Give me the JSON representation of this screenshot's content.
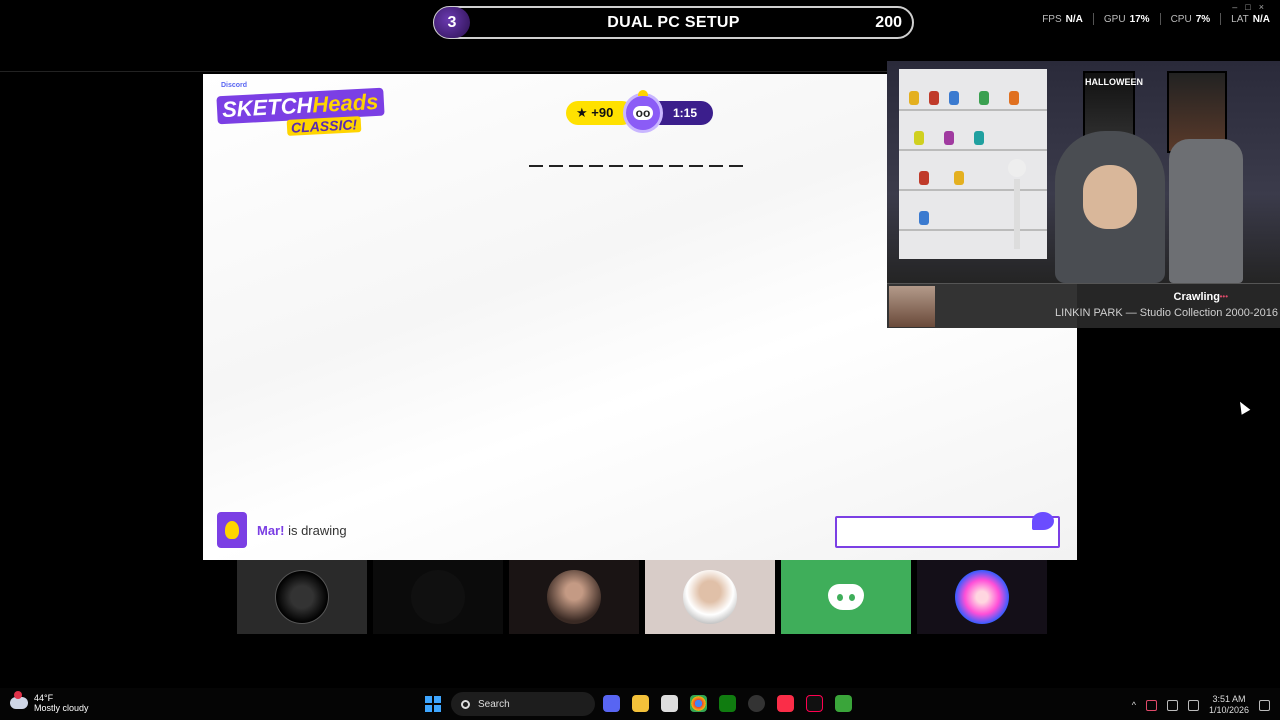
{
  "overlay": {
    "round": "3",
    "title": "DUAL PC SETUP",
    "score": "200"
  },
  "perf": {
    "fps_label": "FPS",
    "fps": "N/A",
    "gpu_label": "GPU",
    "gpu": "17%",
    "cpu_label": "CPU",
    "cpu": "7%",
    "lat_label": "LAT",
    "lat": "N/A"
  },
  "game": {
    "logo_brand": "Discord",
    "logo_sketch": "SKETCH",
    "logo_heads": "Heads",
    "logo_classic": "CLASSIC!",
    "points": "★ +90",
    "timer": "1:15",
    "drawer_name": "Mar!",
    "drawer_status": " is drawing",
    "guess_placeholder": ""
  },
  "stream": {
    "poster_title": "HALLOWEEN",
    "song": "Crawling",
    "album": "LINKIN PARK — Studio Collection 2000-2016"
  },
  "taskbar": {
    "temp": "44°F",
    "weather": "Mostly cloudy",
    "search": "Search",
    "time": "3:51 AM",
    "date": "1/10/2026"
  }
}
